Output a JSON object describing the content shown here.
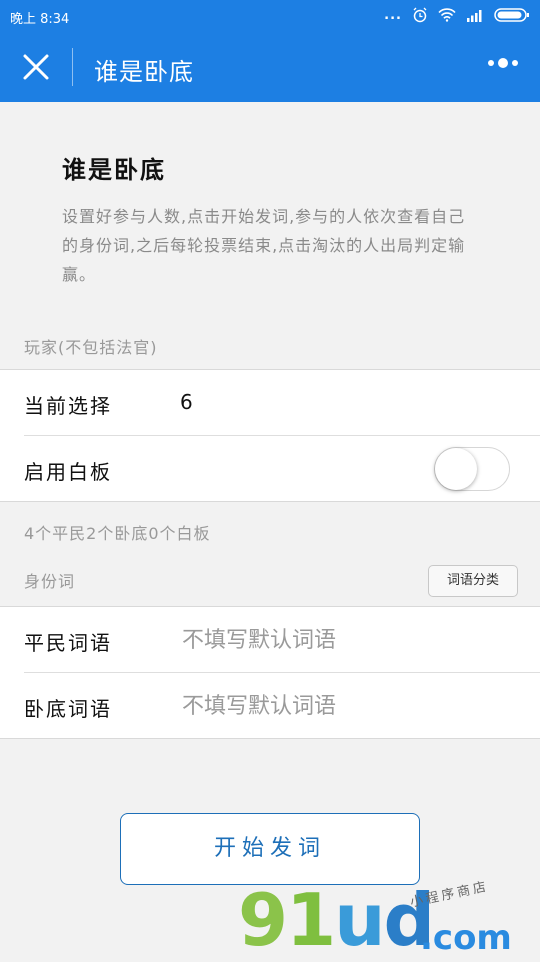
{
  "status_bar": {
    "time": "晚上 8:34",
    "signal_dots": "..."
  },
  "nav": {
    "title": "谁是卧底"
  },
  "intro": {
    "title": "谁是卧底",
    "description": "设置好参与人数,点击开始发词,参与的人依次查看自己的身份词,之后每轮投票结束,点击淘汰的人出局判定输赢。"
  },
  "players": {
    "section_label": "玩家(不包括法官)",
    "current_select_label": "当前选择",
    "current_select_value": "6",
    "blank_toggle_label": "启用白板",
    "blank_enabled": false,
    "summary": "4个平民2个卧底0个白板"
  },
  "words": {
    "section_label": "身份词",
    "classify_button": "词语分类",
    "civilian_label": "平民词语",
    "civilian_placeholder": "不填写默认词语",
    "spy_label": "卧底词语",
    "spy_placeholder": "不填写默认词语"
  },
  "start_button": "开始发词",
  "watermark": {
    "logo_g": "9",
    "logo_l": "1",
    "logo_u": "u",
    "logo_d": "d",
    "domain": ".com",
    "tagline": "小程序商店"
  },
  "colors": {
    "primary": "#1d7fe3",
    "button": "#1d6fb8"
  }
}
